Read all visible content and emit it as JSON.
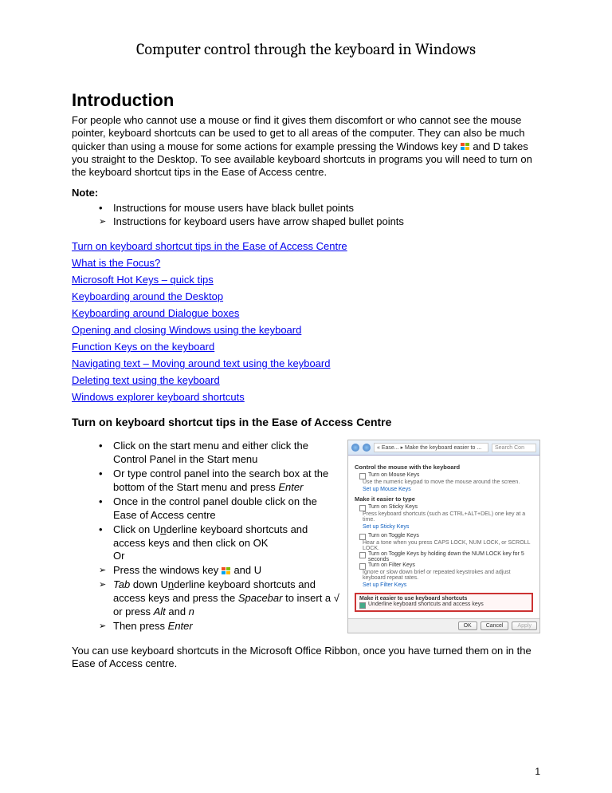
{
  "title": "Computer control through the keyboard in Windows",
  "intro": {
    "heading": "Introduction",
    "p1a": "For people who cannot use a mouse or find it gives them discomfort or who cannot see the mouse pointer, keyboard shortcuts can be used to get to all areas of the computer. They can also be much quicker than using a mouse for some actions for example pressing the Windows key ",
    "p1b": "and D takes you straight to the Desktop. To see available keyboard shortcuts in programs you will need to turn on the keyboard shortcut tips in the Ease of Access centre."
  },
  "note": {
    "label": "Note:",
    "mouse": "Instructions for mouse users have black bullet points",
    "keyboard": "Instructions for keyboard users have arrow shaped bullet points"
  },
  "links": [
    "Turn on keyboard shortcut tips in the Ease of Access Centre",
    "What is the Focus?",
    "Microsoft Hot Keys – quick tips",
    "Keyboarding around the Desktop",
    "Keyboarding around Dialogue boxes",
    "Opening and closing Windows using the keyboard",
    "Function Keys on the keyboard",
    "Navigating text – Moving around text using the keyboard",
    "Deleting text using the keyboard",
    "Windows explorer keyboard shortcuts"
  ],
  "section2": {
    "heading": "Turn on keyboard shortcut tips in the Ease of Access Centre",
    "steps": [
      {
        "type": "dot",
        "html": "Click on the start menu and either click  the Control Panel in the Start menu"
      },
      {
        "type": "dot",
        "html": "Or type control panel into the search box at the bottom of the Start menu and press <em>Enter</em>"
      },
      {
        "type": "dot",
        "html": "Once in the control panel double click on the Ease of Access centre"
      },
      {
        "type": "dot",
        "html": "Click on U<span class=\"u\">n</span>derline  keyboard shortcuts and access keys and then click on OK<br>Or"
      },
      {
        "type": "arrow",
        "html": "Press the windows key <span class=\"win-icon\" data-name=\"windows-key-icon\" data-interactable=\"false\"><span></span><span></span><span></span><span></span></span> and U"
      },
      {
        "type": "arrow",
        "html": "<em>Tab</em> down U<span class=\"u\">n</span>derline  keyboard shortcuts and access keys and press the  <em>Spacebar</em> to insert a √ or press <em>Alt</em> and <em>n</em>"
      },
      {
        "type": "arrow",
        "html": "Then press <em>Enter</em>"
      }
    ],
    "closing": "You can use keyboard shortcuts in the Microsoft Office Ribbon, once you have turned them on in the Ease of Access centre."
  },
  "screenshot": {
    "breadcrumb": "« Ease... ▸ Make the keyboard easier to ...",
    "search": "Search Con",
    "g1": {
      "title": "Control the mouse with the keyboard",
      "check": "Turn on Mouse Keys",
      "sub": "Use the numeric keypad to move the mouse around the screen.",
      "link": "Set up Mouse Keys"
    },
    "g2": {
      "title": "Make it easier to type",
      "c1": "Turn on Sticky Keys",
      "s1": "Press keyboard shortcuts (such as CTRL+ALT+DEL) one key at a time.",
      "l1": "Set up Sticky Keys",
      "c2": "Turn on Toggle Keys",
      "s2a": "Hear a tone when you press CAPS LOCK, NUM LOCK, or SCROLL LOCK.",
      "s2b": "Turn on Toggle Keys by holding down the NUM LOCK key for 5 seconds",
      "c3": "Turn on Filter Keys",
      "s3": "Ignore or slow down brief or repeated keystrokes and adjust keyboard repeat rates.",
      "l3": "Set up Filter Keys"
    },
    "hl": {
      "title": "Make it easier to use keyboard shortcuts",
      "check": "Underline keyboard shortcuts and access keys"
    },
    "buttons": {
      "ok": "OK",
      "cancel": "Cancel",
      "apply": "Apply"
    }
  },
  "page_number": "1"
}
